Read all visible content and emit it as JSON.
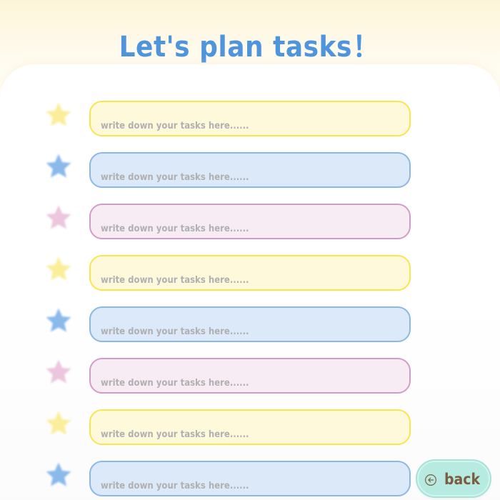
{
  "header": {
    "title": "Let's plan tasks！"
  },
  "tasks": [
    {
      "star_color": "#fbee9a",
      "placeholder": "write down your tasks here......",
      "value": ""
    },
    {
      "star_color": "#8ab9ec",
      "placeholder": "write down your tasks here......",
      "value": ""
    },
    {
      "star_color": "#ecc6de",
      "placeholder": "write down your tasks here......",
      "value": ""
    },
    {
      "star_color": "#fbee9a",
      "placeholder": "write down your tasks here......",
      "value": ""
    },
    {
      "star_color": "#8ab9ec",
      "placeholder": "write down your tasks here......",
      "value": ""
    },
    {
      "star_color": "#ecc6de",
      "placeholder": "write down your tasks here......",
      "value": ""
    },
    {
      "star_color": "#fbee9a",
      "placeholder": "write down your tasks here......",
      "value": ""
    },
    {
      "star_color": "#8ab9ec",
      "placeholder": "write down your tasks here......",
      "value": ""
    }
  ],
  "back_button": {
    "label": "back",
    "icon": "arrow-left-circle-icon"
  },
  "colors": {
    "title": "#4f95dd",
    "yellow_field": "#fff9dc",
    "yellow_border": "#fae54a",
    "blue_field": "#dce9f9",
    "blue_border": "#8bb8e6",
    "pink_field": "#f8ecf4",
    "pink_border": "#d49bca",
    "back_button": "#b7ebe1",
    "back_text": "#7a5c40"
  }
}
